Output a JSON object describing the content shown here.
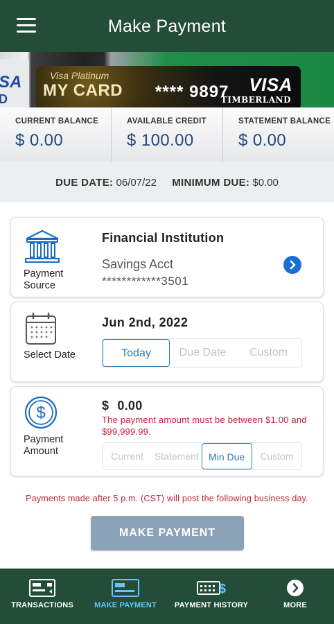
{
  "header": {
    "title": "Make Payment",
    "menu_icon": "hamburger-menu-icon"
  },
  "card": {
    "left_card_text_a": "SA",
    "left_card_text_b": "D",
    "subtitle": "Visa Platinum",
    "name": "MY CARD",
    "masked_number": "**** 9897",
    "brand": "VISA",
    "bank": "TIMBERLAND"
  },
  "balances": [
    {
      "label": "CURRENT BALANCE",
      "value": "$ 0.00"
    },
    {
      "label": "AVAILABLE CREDIT",
      "value": "$ 100.00"
    },
    {
      "label": "STATEMENT BALANCE",
      "value": "$ 0.00"
    }
  ],
  "due": {
    "due_date_label": "DUE DATE:",
    "due_date_value": "06/07/22",
    "minimum_due_label": "MINIMUM DUE:",
    "minimum_due_value": "$0.00"
  },
  "payment_source": {
    "icon_label_line1": "Payment",
    "icon_label_line2": "Source",
    "institution": "Financial Institution",
    "account_name": "Savings Acct",
    "account_number": "************3501"
  },
  "select_date": {
    "icon_label": "Select Date",
    "selected_date": "Jun 2nd, 2022",
    "options": [
      "Today",
      "Due Date",
      "Custom"
    ],
    "active_option": "Today"
  },
  "payment_amount": {
    "icon_label_line1": "Payment",
    "icon_label_line2": "Amount",
    "currency_symbol": "$",
    "amount": "0.00",
    "error": "The payment amount must be between $1.00 and $99,999.99.",
    "options": [
      "Current",
      "Statement",
      "Min Due",
      "Custom"
    ],
    "active_option": "Min Due"
  },
  "notice": "Payments made after 5 p.m. (CST) will post the following business day.",
  "make_payment_button": "MAKE PAYMENT",
  "colors": {
    "header_green": "#234d39",
    "accent_blue": "#2b79b6",
    "error_red": "#c2223c",
    "button_disabled": "#8ca2b6",
    "nav_active": "#62c7ff"
  },
  "bottom_nav": [
    {
      "label": "TRANSACTIONS",
      "icon": "transactions-icon",
      "active": false
    },
    {
      "label": "MAKE PAYMENT",
      "icon": "card-payment-icon",
      "active": true
    },
    {
      "label": "PAYMENT HISTORY",
      "icon": "payment-history-icon",
      "active": false
    },
    {
      "label": "MORE",
      "icon": "more-chevron-icon",
      "active": false
    }
  ]
}
